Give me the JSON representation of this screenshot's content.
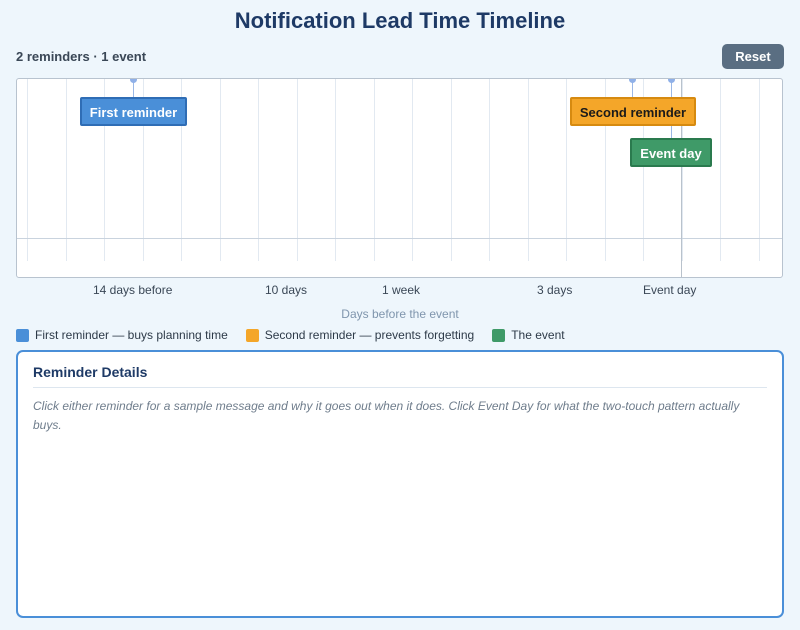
{
  "page": {
    "title": "Notification Lead Time Timeline"
  },
  "summary": "2 reminders · 1 event",
  "toolbar": {
    "reset_label": "Reset"
  },
  "timeline": {
    "markers": [
      {
        "id": "first",
        "label": "First reminder",
        "days_before": 13.7,
        "color": "#4a8fd8"
      },
      {
        "id": "second",
        "label": "Second reminder",
        "days_before": 0.6,
        "color": "#f4a629"
      },
      {
        "id": "event",
        "label": "Event day",
        "days_before": 0,
        "color": "#3f9a68"
      }
    ],
    "ticks": [
      "14 days before",
      "10 days",
      "1 week",
      "3 days",
      "Event day"
    ],
    "axis_label": "Days before the event"
  },
  "legend": [
    {
      "label": "First reminder — buys planning time",
      "color": "#4a8fd8"
    },
    {
      "label": "Second reminder — prevents forgetting",
      "color": "#f4a629"
    },
    {
      "label": "The event",
      "color": "#3f9a68"
    }
  ],
  "details": {
    "title": "Reminder Details",
    "placeholder": "Click either reminder for a sample message and why it goes out when it does. Click Event Day for what the two-touch pattern actually buys."
  }
}
